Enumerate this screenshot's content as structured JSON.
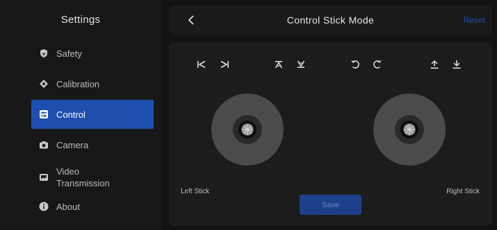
{
  "sidebar": {
    "title": "Settings",
    "items": [
      {
        "label": "Safety",
        "icon": "shield-icon",
        "active": false
      },
      {
        "label": "Calibration",
        "icon": "diamond-icon",
        "active": false
      },
      {
        "label": "Control",
        "icon": "control-icon",
        "active": true
      },
      {
        "label": "Camera",
        "icon": "camera-icon",
        "active": false
      },
      {
        "label": "Video\nTransmission",
        "icon": "video-transmission-icon",
        "active": false
      },
      {
        "label": "About",
        "icon": "info-icon",
        "active": false
      }
    ]
  },
  "header": {
    "title": "Control Stick Mode",
    "reset_label": "Reset"
  },
  "main": {
    "control_icons": [
      "skip-back-icon",
      "skip-forward-icon",
      "tilt-up-icon",
      "tilt-down-icon",
      "rotate-left-icon",
      "rotate-right-icon",
      "ascend-icon",
      "descend-icon"
    ],
    "left_stick_label": "Left Stick",
    "right_stick_label": "Right Stick",
    "save_label": "Save"
  },
  "colors": {
    "accent": "#1e4fb0",
    "save_button": "#1e3f8a"
  }
}
